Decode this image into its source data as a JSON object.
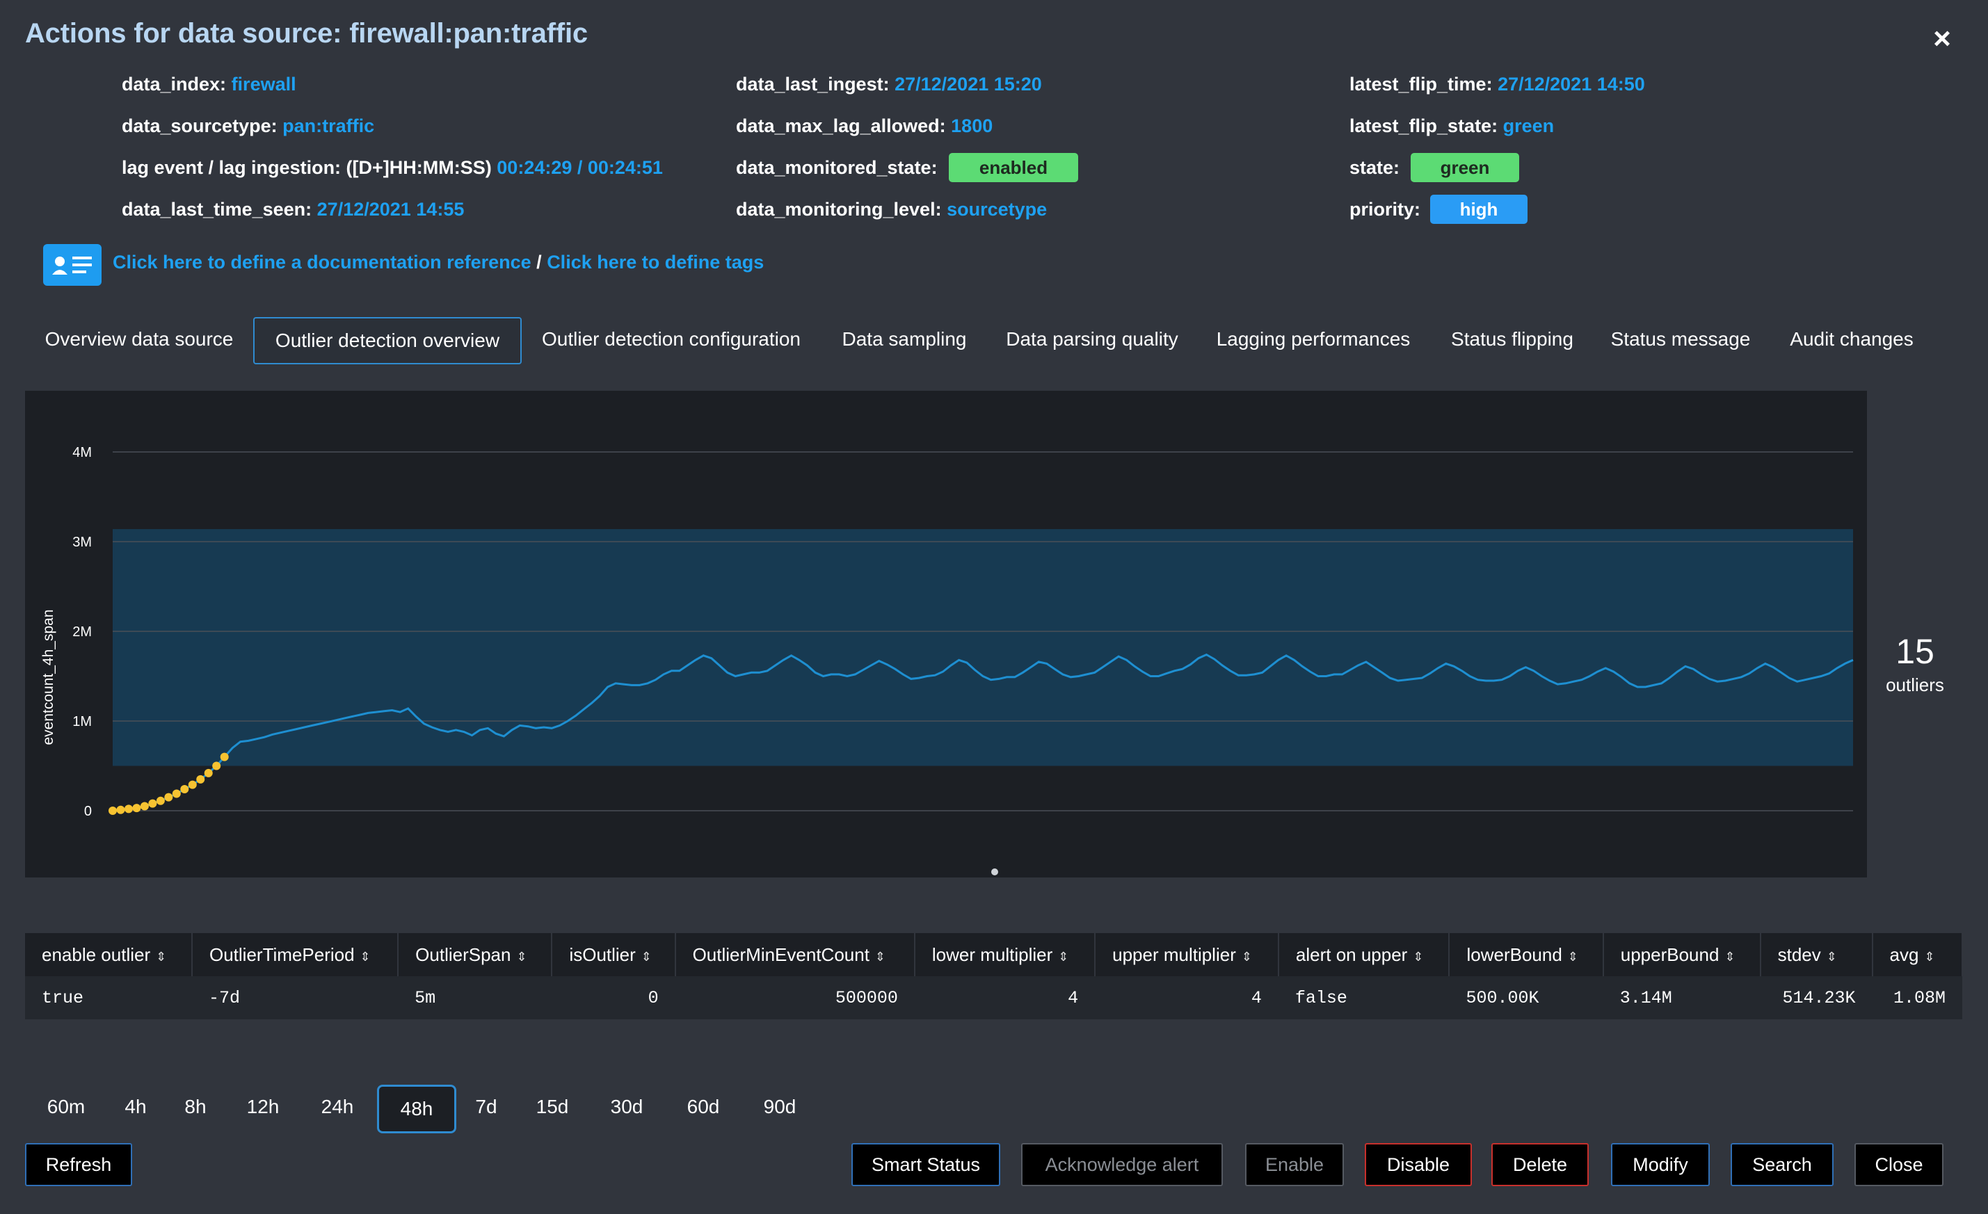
{
  "title": "Actions for data source: firewall:pan:traffic",
  "close_icon": "×",
  "info": {
    "data_index": {
      "key": "data_index:",
      "value": "firewall"
    },
    "data_sourcetype": {
      "key": "data_sourcetype:",
      "value": "pan:traffic"
    },
    "lag": {
      "key": "lag event / lag ingestion: ([D+]HH:MM:SS)",
      "value": "00:24:29 / 00:24:51"
    },
    "data_last_time_seen": {
      "key": "data_last_time_seen:",
      "value": "27/12/2021 14:55"
    },
    "data_last_ingest": {
      "key": "data_last_ingest:",
      "value": "27/12/2021 15:20"
    },
    "data_max_lag_allowed": {
      "key": "data_max_lag_allowed:",
      "value": "1800"
    },
    "data_monitored_state": {
      "key": "data_monitored_state:",
      "value": "enabled"
    },
    "data_monitoring_level": {
      "key": "data_monitoring_level:",
      "value": "sourcetype"
    },
    "latest_flip_time": {
      "key": "latest_flip_time:",
      "value": "27/12/2021 14:50"
    },
    "latest_flip_state": {
      "key": "latest_flip_state:",
      "value": "green"
    },
    "state": {
      "key": "state:",
      "value": "green"
    },
    "priority": {
      "key": "priority:",
      "value": "high"
    }
  },
  "doc": {
    "icon": "contact-card-icon",
    "link_doc": "Click here to define a documentation reference",
    "separator": " / ",
    "link_tags": "Click here to define tags"
  },
  "tabs": [
    {
      "label": "Overview data source"
    },
    {
      "label": "Outlier detection overview",
      "active": true
    },
    {
      "label": "Outlier detection configuration"
    },
    {
      "label": "Data sampling"
    },
    {
      "label": "Data parsing quality"
    },
    {
      "label": "Lagging performances"
    },
    {
      "label": "Status flipping"
    },
    {
      "label": "Status message"
    },
    {
      "label": "Audit changes"
    }
  ],
  "chart_data": {
    "type": "line",
    "ylabel": "eventcount_4h_span",
    "ylim": [
      0,
      4000000
    ],
    "yticks": [
      {
        "v": 0,
        "label": "0"
      },
      {
        "v": 1000000,
        "label": "1M"
      },
      {
        "v": 2000000,
        "label": "2M"
      },
      {
        "v": 3000000,
        "label": "3M"
      },
      {
        "v": 4000000,
        "label": "4M"
      }
    ],
    "band": {
      "lower": 500000,
      "upper": 3140000
    },
    "colors": {
      "line": "#1e8fd1",
      "band": "#173a52",
      "outlier": "#f7c331",
      "grid": "#4a4f57"
    },
    "series": [
      {
        "values": [
          0,
          10000,
          20000,
          30000,
          50000,
          80000,
          110000,
          150000,
          190000,
          240000,
          290000,
          350000,
          420000,
          500000,
          600000,
          700000,
          770000,
          780000,
          800000,
          820000,
          850000,
          870000,
          890000,
          910000,
          930000,
          950000,
          970000,
          990000,
          1010000,
          1030000,
          1050000,
          1070000,
          1090000,
          1100000,
          1110000,
          1120000,
          1100000,
          1140000,
          1050000,
          970000,
          930000,
          900000,
          880000,
          900000,
          880000,
          840000,
          900000,
          920000,
          860000,
          830000,
          900000,
          950000,
          940000,
          920000,
          930000,
          920000,
          950000,
          1000000,
          1060000,
          1130000,
          1200000,
          1280000,
          1380000,
          1420000,
          1410000,
          1400000,
          1400000,
          1420000,
          1460000,
          1520000,
          1560000,
          1560000,
          1620000,
          1680000,
          1730000,
          1700000,
          1620000,
          1540000,
          1500000,
          1520000,
          1540000,
          1540000,
          1560000,
          1620000,
          1680000,
          1730000,
          1680000,
          1620000,
          1540000,
          1500000,
          1520000,
          1520000,
          1500000,
          1520000,
          1570000,
          1620000,
          1670000,
          1630000,
          1580000,
          1520000,
          1470000,
          1480000,
          1500000,
          1510000,
          1550000,
          1620000,
          1680000,
          1650000,
          1570000,
          1500000,
          1460000,
          1470000,
          1490000,
          1490000,
          1540000,
          1600000,
          1660000,
          1640000,
          1580000,
          1520000,
          1490000,
          1500000,
          1520000,
          1540000,
          1600000,
          1660000,
          1720000,
          1680000,
          1610000,
          1550000,
          1500000,
          1500000,
          1530000,
          1560000,
          1580000,
          1630000,
          1700000,
          1740000,
          1690000,
          1620000,
          1560000,
          1510000,
          1510000,
          1520000,
          1540000,
          1610000,
          1680000,
          1730000,
          1680000,
          1610000,
          1550000,
          1500000,
          1500000,
          1520000,
          1520000,
          1570000,
          1620000,
          1660000,
          1600000,
          1540000,
          1480000,
          1450000,
          1460000,
          1470000,
          1480000,
          1530000,
          1590000,
          1640000,
          1610000,
          1560000,
          1500000,
          1460000,
          1450000,
          1450000,
          1460000,
          1500000,
          1560000,
          1600000,
          1560000,
          1500000,
          1450000,
          1410000,
          1420000,
          1440000,
          1460000,
          1500000,
          1550000,
          1590000,
          1550000,
          1490000,
          1420000,
          1380000,
          1380000,
          1400000,
          1420000,
          1480000,
          1550000,
          1610000,
          1580000,
          1520000,
          1470000,
          1440000,
          1450000,
          1470000,
          1490000,
          1530000,
          1590000,
          1640000,
          1600000,
          1540000,
          1480000,
          1440000,
          1460000,
          1480000,
          1500000,
          1530000,
          1590000,
          1640000,
          1680000
        ]
      },
      {
        "name": "outliers",
        "points": [
          0,
          1,
          2,
          3,
          4,
          5,
          6,
          7,
          8,
          9,
          10,
          11,
          12,
          13,
          14
        ]
      }
    ]
  },
  "outliers": {
    "count": "15",
    "label": "outliers"
  },
  "table": {
    "columns": [
      "enable outlier",
      "OutlierTimePeriod",
      "OutlierSpan",
      "isOutlier",
      "OutlierMinEventCount",
      "lower multiplier",
      "upper multiplier",
      "alert on upper",
      "lowerBound",
      "upperBound",
      "stdev",
      "avg"
    ],
    "sort_icon": "⇕",
    "rows": [
      [
        "true",
        "-7d",
        "5m",
        "0",
        "500000",
        "4",
        "4",
        "false",
        "500.00K",
        "3.14M",
        "514.23K",
        "1.08M"
      ]
    ]
  },
  "ranges": [
    "60m",
    "4h",
    "8h",
    "12h",
    "24h",
    "48h",
    "7d",
    "15d",
    "30d",
    "60d",
    "90d"
  ],
  "active_range": "48h",
  "buttons": {
    "refresh": "Refresh",
    "smart_status": "Smart Status",
    "ack": "Acknowledge alert",
    "enable": "Enable",
    "disable": "Disable",
    "delete": "Delete",
    "modify": "Modify",
    "search": "Search",
    "close": "Close"
  }
}
